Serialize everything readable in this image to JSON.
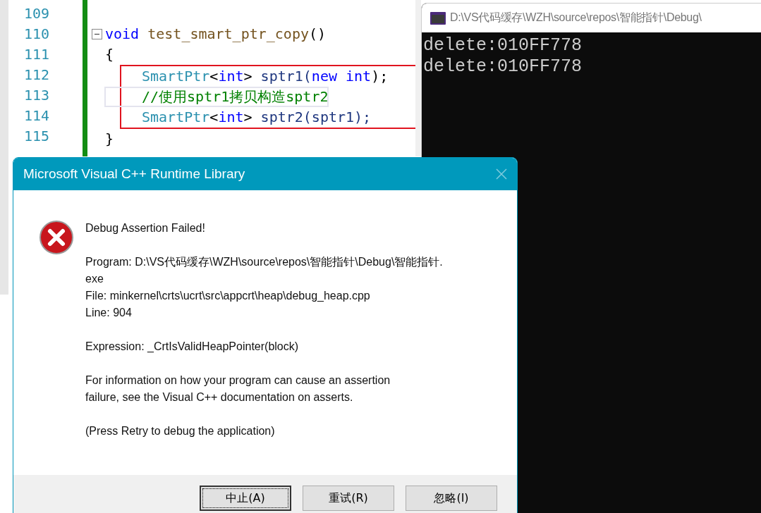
{
  "editor": {
    "lines": [
      {
        "number": "109"
      },
      {
        "number": "110",
        "expanded": true,
        "tokens": [
          {
            "kind": "keyword",
            "text": "void"
          },
          {
            "kind": "function",
            "text": " test_smart_ptr_copy"
          },
          {
            "kind": "punct",
            "text": "()"
          }
        ]
      },
      {
        "number": "111",
        "tokens": [
          {
            "kind": "punct",
            "text": "{"
          }
        ],
        "highlighted_children": true,
        "children": [
          {
            "number": "112",
            "tokens": [
              {
                "kind": "type",
                "text": "SmartPtr"
              },
              {
                "kind": "punct",
                "text": "<"
              },
              {
                "kind": "keyword",
                "text": "int"
              },
              {
                "kind": "punct",
                "text": ">"
              },
              {
                "kind": "ident",
                "text": " sptr1("
              },
              {
                "kind": "keyword",
                "text": "new"
              },
              {
                "kind": "keyword",
                "text": " int"
              },
              {
                "kind": "punct",
                "text": ");"
              }
            ]
          },
          {
            "number": "113",
            "current": true,
            "tokens": [
              {
                "kind": "comment",
                "text": "//使用sptr1拷贝构造sptr2"
              }
            ]
          },
          {
            "number": "114",
            "tokens": [
              {
                "kind": "type",
                "text": "SmartPtr"
              },
              {
                "kind": "punct",
                "text": "<"
              },
              {
                "kind": "keyword",
                "text": "int"
              },
              {
                "kind": "punct",
                "text": ">"
              },
              {
                "kind": "ident",
                "text": " sptr2(sptr1);"
              }
            ]
          }
        ]
      },
      {
        "number": "115",
        "tokens": [
          {
            "kind": "punct",
            "text": "}"
          }
        ]
      }
    ]
  },
  "console": {
    "title": "D:\\VS代码缓存\\WZH\\source\\repos\\智能指针\\Debug\\",
    "output": [
      "delete:010FF778",
      "delete:010FF778"
    ]
  },
  "dialog": {
    "title": "Microsoft Visual C++ Runtime Library",
    "heading": "Debug Assertion Failed!",
    "details": [
      "Program: D:\\VS代码缓存\\WZH\\source\\repos\\智能指针\\Debug\\智能指针.\nexe",
      "File: minkernel\\crts\\ucrt\\src\\appcrt\\heap\\debug_heap.cpp",
      "Line: 904"
    ],
    "expression": "Expression: _CrtIsValidHeapPointer(block)",
    "info": "For information on how your program can cause an assertion\nfailure, see the Visual C++ documentation on asserts.",
    "hint": "(Press Retry to debug the application)",
    "buttons": [
      {
        "label": "中止(A)",
        "focused": true
      },
      {
        "label": "重试(R)",
        "focused": false
      },
      {
        "label": "忽略(I)",
        "focused": false
      }
    ]
  }
}
